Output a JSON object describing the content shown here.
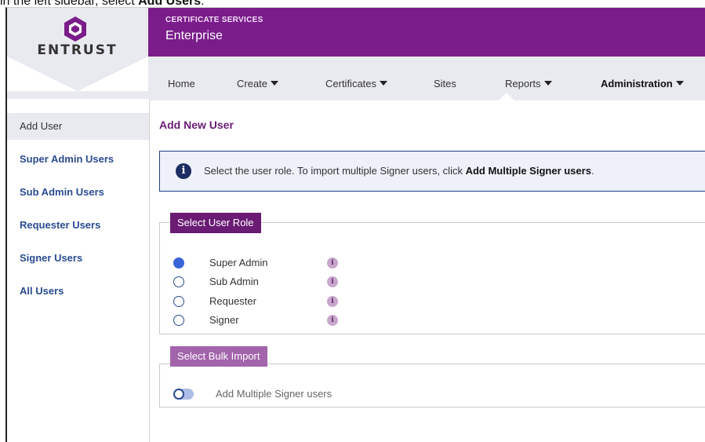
{
  "caption": {
    "prefix": "in the left sidebar, select ",
    "emphasis": "Add Users",
    "suffix": "."
  },
  "brand": {
    "logo_text": "ENTRUST",
    "service_label": "CERTIFICATE SERVICES",
    "product_name": "Enterprise",
    "colors": {
      "header": "#7a1c8a",
      "accent": "#6a1b74",
      "link": "#2a4c92"
    }
  },
  "nav": {
    "items": [
      {
        "label": "Home",
        "has_menu": false,
        "active": false
      },
      {
        "label": "Create",
        "has_menu": true,
        "active": false
      },
      {
        "label": "Certificates",
        "has_menu": true,
        "active": false
      },
      {
        "label": "Sites",
        "has_menu": false,
        "active": false
      },
      {
        "label": "Reports",
        "has_menu": true,
        "active": false
      },
      {
        "label": "Administration",
        "has_menu": true,
        "active": true
      }
    ]
  },
  "sidebar": {
    "items": [
      {
        "label": "Add User",
        "current": true
      },
      {
        "label": "Super Admin Users",
        "current": false
      },
      {
        "label": "Sub Admin Users",
        "current": false
      },
      {
        "label": "Requester Users",
        "current": false
      },
      {
        "label": "Signer Users",
        "current": false
      },
      {
        "label": "All Users",
        "current": false
      }
    ]
  },
  "main": {
    "title": "Add New User",
    "info": {
      "icon": "info-icon",
      "text": "Select the user role. To import multiple Signer users, click ",
      "link_text": "Add Multiple Signer users",
      "suffix": "."
    },
    "role_section": {
      "legend": "Select User Role",
      "options": [
        {
          "label": "Super Admin",
          "checked": true
        },
        {
          "label": "Sub Admin",
          "checked": false
        },
        {
          "label": "Requester",
          "checked": false
        },
        {
          "label": "Signer",
          "checked": false
        }
      ]
    },
    "bulk_section": {
      "legend": "Select Bulk Import",
      "toggle_label": "Add Multiple Signer users",
      "toggle_on": false
    }
  }
}
